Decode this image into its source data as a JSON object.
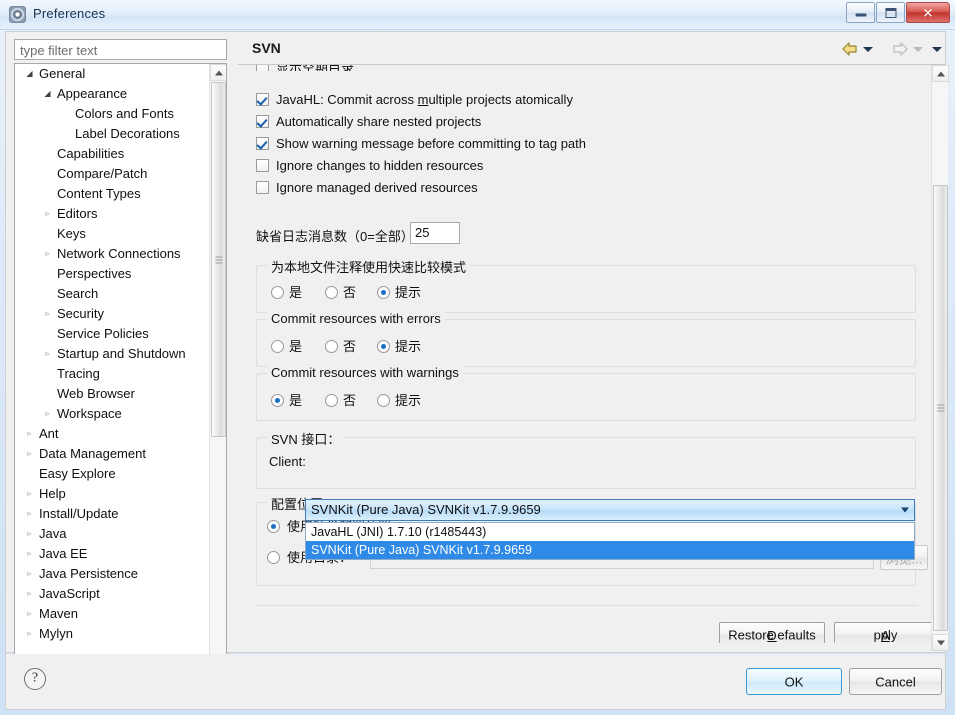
{
  "window": {
    "title": "Preferences",
    "icon": "preferences-gear-icon",
    "controls": {
      "minimize": "minimize-button",
      "maximize": "maximize-button",
      "close_glyph": "✕"
    }
  },
  "filter": {
    "placeholder": "type filter text",
    "value": ""
  },
  "tree": {
    "items": [
      {
        "label": "General",
        "indent": 0,
        "twisty": "open"
      },
      {
        "label": "Appearance",
        "indent": 1,
        "twisty": "open"
      },
      {
        "label": "Colors and Fonts",
        "indent": 2,
        "twisty": "none"
      },
      {
        "label": "Label Decorations",
        "indent": 2,
        "twisty": "none"
      },
      {
        "label": "Capabilities",
        "indent": 1,
        "twisty": "none"
      },
      {
        "label": "Compare/Patch",
        "indent": 1,
        "twisty": "none"
      },
      {
        "label": "Content Types",
        "indent": 1,
        "twisty": "none"
      },
      {
        "label": "Editors",
        "indent": 1,
        "twisty": "closed"
      },
      {
        "label": "Keys",
        "indent": 1,
        "twisty": "none"
      },
      {
        "label": "Network Connections",
        "indent": 1,
        "twisty": "closed"
      },
      {
        "label": "Perspectives",
        "indent": 1,
        "twisty": "none"
      },
      {
        "label": "Search",
        "indent": 1,
        "twisty": "none"
      },
      {
        "label": "Security",
        "indent": 1,
        "twisty": "closed"
      },
      {
        "label": "Service Policies",
        "indent": 1,
        "twisty": "none"
      },
      {
        "label": "Startup and Shutdown",
        "indent": 1,
        "twisty": "closed"
      },
      {
        "label": "Tracing",
        "indent": 1,
        "twisty": "none"
      },
      {
        "label": "Web Browser",
        "indent": 1,
        "twisty": "none"
      },
      {
        "label": "Workspace",
        "indent": 1,
        "twisty": "closed"
      },
      {
        "label": "Ant",
        "indent": 0,
        "twisty": "closed"
      },
      {
        "label": "Data Management",
        "indent": 0,
        "twisty": "closed"
      },
      {
        "label": "Easy Explore",
        "indent": 0,
        "twisty": "none"
      },
      {
        "label": "Help",
        "indent": 0,
        "twisty": "closed"
      },
      {
        "label": "Install/Update",
        "indent": 0,
        "twisty": "closed"
      },
      {
        "label": "Java",
        "indent": 0,
        "twisty": "closed"
      },
      {
        "label": "Java EE",
        "indent": 0,
        "twisty": "closed"
      },
      {
        "label": "Java Persistence",
        "indent": 0,
        "twisty": "closed"
      },
      {
        "label": "JavaScript",
        "indent": 0,
        "twisty": "closed"
      },
      {
        "label": "Maven",
        "indent": 0,
        "twisty": "closed"
      },
      {
        "label": "Mylyn",
        "indent": 0,
        "twisty": "closed"
      }
    ]
  },
  "page": {
    "title": "SVN",
    "nav": {
      "back": "back-arrow-icon",
      "back_menu": "back-dropdown-caret",
      "forward": "forward-arrow-icon",
      "forward_menu": "forward-dropdown-caret",
      "view_menu": "view-menu-caret"
    },
    "checkboxes": [
      {
        "label": "显示空期目录",
        "checked": false,
        "clipped": true,
        "mnemonic": ""
      },
      {
        "label": "JavaHL: Commit across multiple projects atomically",
        "checked": true,
        "clipped": false,
        "mnemonic": "m"
      },
      {
        "label": "Automatically share nested projects",
        "checked": true,
        "clipped": false,
        "mnemonic": ""
      },
      {
        "label": "Show warning message before committing to tag path",
        "checked": true,
        "clipped": false,
        "mnemonic": ""
      },
      {
        "label": "Ignore changes to hidden resources",
        "checked": false,
        "clipped": false,
        "mnemonic": ""
      },
      {
        "label": "Ignore managed derived resources",
        "checked": false,
        "clipped": false,
        "mnemonic": ""
      }
    ],
    "log_messages": {
      "label": "缺省日志消息数（0=全部）",
      "value": "25"
    },
    "radio_groups": [
      {
        "title": "为本地文件注释使用快速比较模式",
        "options": [
          {
            "label": "是",
            "selected": false
          },
          {
            "label": "否",
            "selected": false
          },
          {
            "label": "提示",
            "selected": true
          }
        ]
      },
      {
        "title": "Commit resources with errors",
        "options": [
          {
            "label": "是",
            "selected": false
          },
          {
            "label": "否",
            "selected": false
          },
          {
            "label": "提示",
            "selected": true
          }
        ]
      },
      {
        "title": "Commit resources with warnings",
        "options": [
          {
            "label": "是",
            "selected": true
          },
          {
            "label": "否",
            "selected": false
          },
          {
            "label": "提示",
            "selected": false
          }
        ]
      }
    ],
    "svn_interface": {
      "group_title": "SVN 接口：",
      "client_label": "Client:",
      "selected": "SVNKit (Pure Java) SVNKit v1.7.9.9659",
      "options": [
        {
          "label": "JavaHL (JNI) 1.7.10 (r1485443)",
          "selected": false
        },
        {
          "label": "SVNKit (Pure Java) SVNKit v1.7.9.9659",
          "selected": true
        }
      ]
    },
    "config_location": {
      "group_title": "配置位置：",
      "option_default": {
        "label": "使用缺省配置位置",
        "selected": true
      },
      "option_directory": {
        "label": "使用目录：",
        "selected": false
      },
      "directory_value": "",
      "browse_label": "浏览..."
    },
    "buttons": {
      "restore_defaults": "Restore Defaults",
      "restore_defaults_mnemonic": "D",
      "apply": "Apply",
      "apply_mnemonic": "A"
    }
  },
  "footer": {
    "help": "?",
    "ok": "OK",
    "cancel": "Cancel"
  },
  "colors": {
    "accent_blue": "#2e8ae6",
    "combo_border": "#3b7cbd",
    "close_red": "#c0332c",
    "ok_border": "#3c9ad6"
  }
}
